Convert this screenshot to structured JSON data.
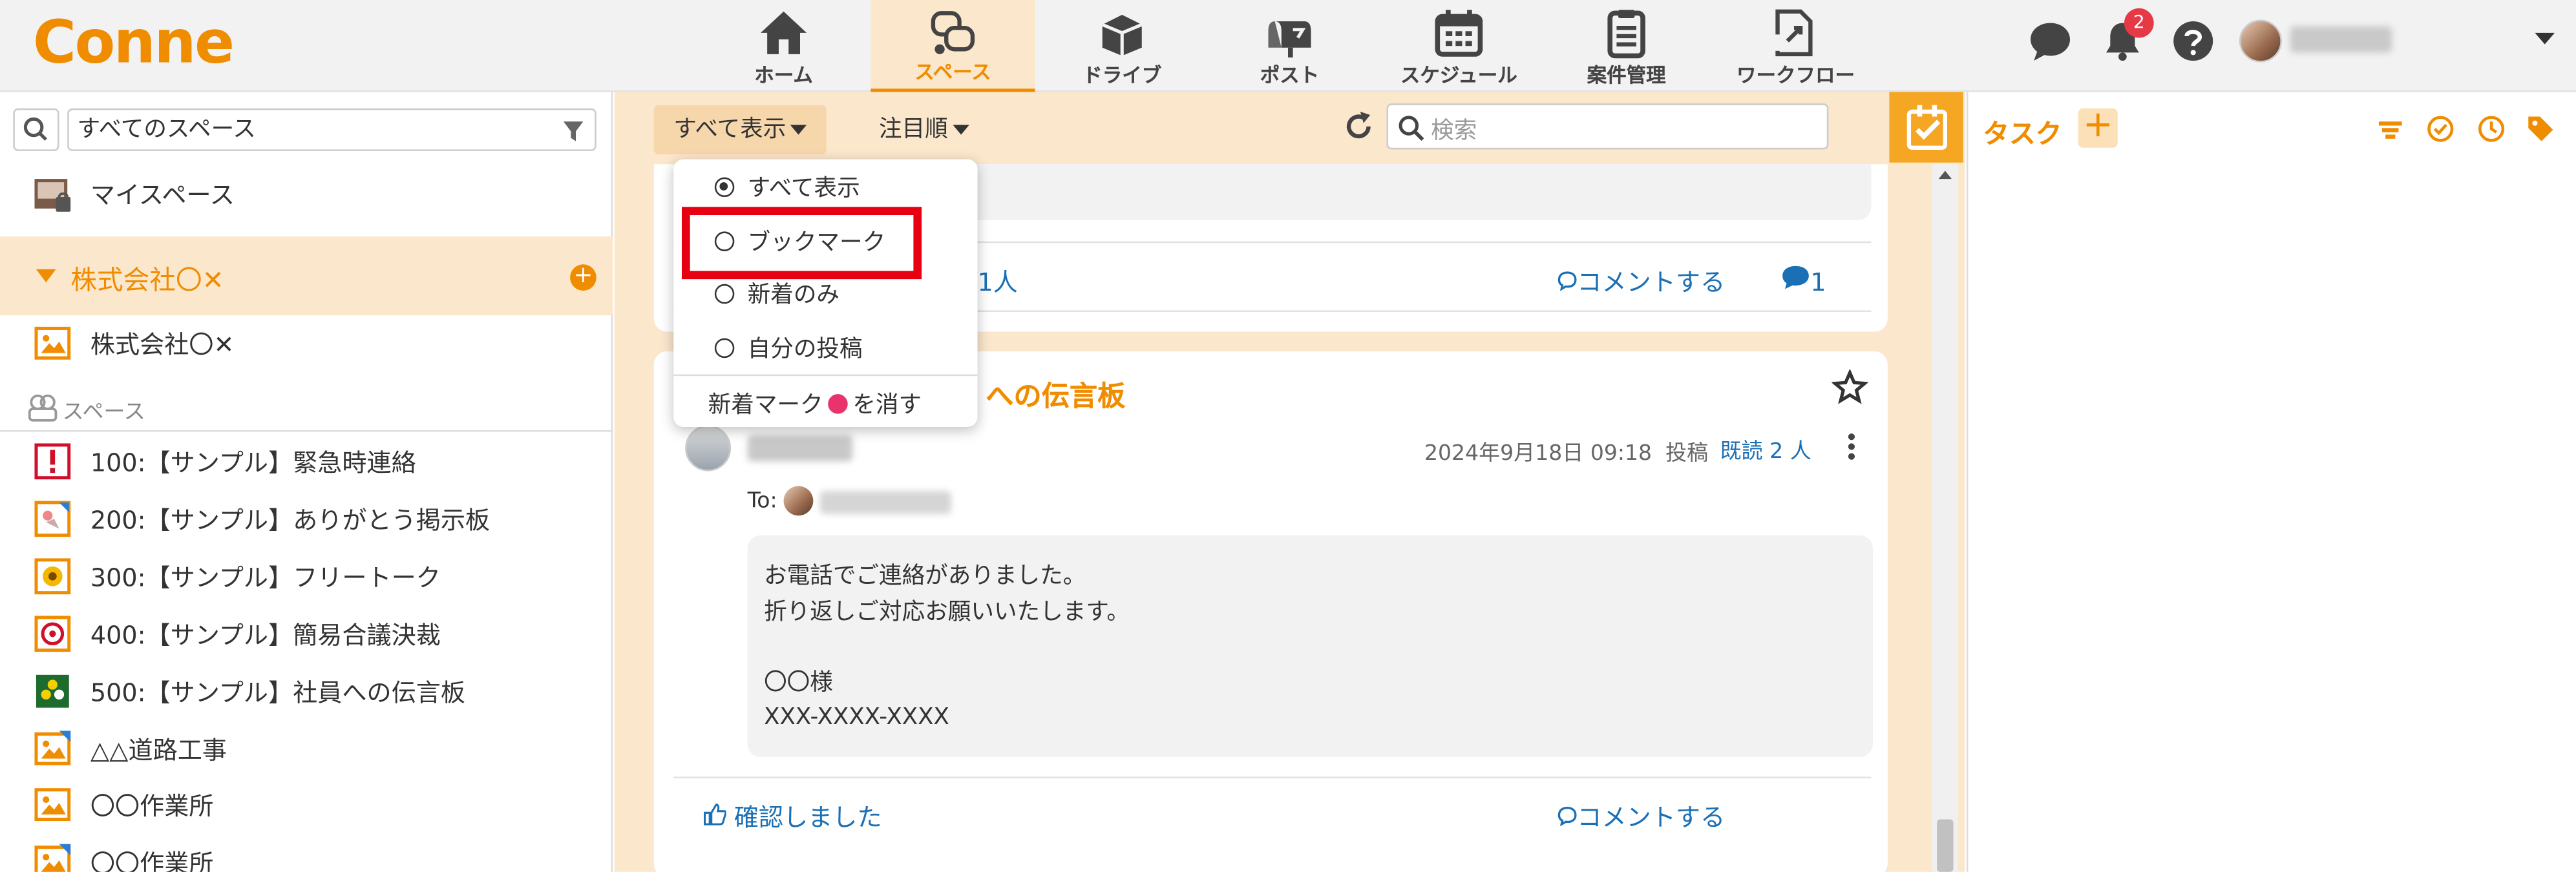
{
  "app": {
    "logo": "Conne",
    "accent": "#f08c00",
    "highlight_color": "#e60012"
  },
  "nav": [
    {
      "label": "ホーム",
      "icon": "home-icon"
    },
    {
      "label": "スペース",
      "icon": "space-chat-icon",
      "active": true
    },
    {
      "label": "ドライブ",
      "icon": "drive-box-icon"
    },
    {
      "label": "ポスト",
      "icon": "post-mailbox-icon"
    },
    {
      "label": "スケジュール",
      "icon": "calendar-icon"
    },
    {
      "label": "案件管理",
      "icon": "clipboard-icon"
    },
    {
      "label": "ワークフロー",
      "icon": "workflow-icon"
    }
  ],
  "header": {
    "notification_count": "2"
  },
  "sidebar": {
    "filter_value": "すべてのスペース",
    "my_space": "マイスペース",
    "company": "株式会社〇✕",
    "company_space": "株式会社〇✕",
    "spaces_label": "スペース",
    "spaces": [
      {
        "label": "100:【サンプル】緊急時連絡",
        "icon": "alert-icon"
      },
      {
        "label": "200:【サンプル】ありがとう掲示板",
        "icon": "thanks-icon"
      },
      {
        "label": "300:【サンプル】フリートーク",
        "icon": "flower-icon"
      },
      {
        "label": "400:【サンプル】簡易合議決裁",
        "icon": "stamp-icon"
      },
      {
        "label": "500:【サンプル】社員への伝言板",
        "icon": "board-icon"
      },
      {
        "label": "△△道路工事",
        "icon": "image-icon"
      },
      {
        "label": "〇〇作業所",
        "icon": "image-icon"
      },
      {
        "label": "〇〇作業所",
        "icon": "image-icon"
      }
    ]
  },
  "toolbar": {
    "show_all": "すべて表示",
    "sort": "注目順",
    "search_placeholder": "検索"
  },
  "dropdown": {
    "items": [
      {
        "label": "すべて表示",
        "selected": true
      },
      {
        "label": "ブックマーク",
        "selected": false
      },
      {
        "label": "新着のみ",
        "selected": false
      },
      {
        "label": "自分の投稿",
        "selected": false
      }
    ],
    "footer_before": "新着マーク",
    "footer_after": "を消す"
  },
  "post_prev": {
    "count_text": "1人",
    "comment": "コメントする",
    "comment_count": "1"
  },
  "post": {
    "title_visible": "への伝言板",
    "date": "2024年9月18日 09:18",
    "posted": "投稿",
    "read": "既読 2 人",
    "to_label": "To:",
    "body": [
      "お電話でご連絡がありました。",
      "折り返しご対応お願いいたします。",
      "",
      "〇〇様",
      "XXX-XXXX-XXXX"
    ],
    "confirm": "確認しました",
    "comment": "コメントする"
  },
  "tasks": {
    "title": "タスク",
    "add": "+"
  }
}
